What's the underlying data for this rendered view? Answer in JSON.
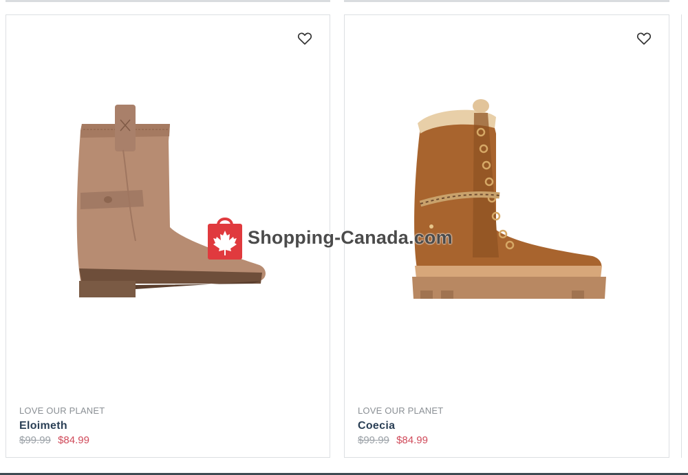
{
  "products": [
    {
      "collection": "LOVE OUR PLANET",
      "name": "Eloimeth",
      "old_price": "$99.99",
      "sale_price": "$84.99",
      "wishlist_icon": "heart-outline-icon",
      "image": "tan-suede-ankle-boot"
    },
    {
      "collection": "LOVE OUR PLANET",
      "name": "Coecia",
      "old_price": "$99.99",
      "sale_price": "$84.99",
      "wishlist_icon": "heart-outline-icon",
      "image": "cognac-lace-up-shearling-boot"
    }
  ],
  "watermark": {
    "text": "Shopping-Canada.com",
    "logo_icon": "maple-leaf-bag-icon",
    "logo_color": "#e03a3e"
  },
  "colors": {
    "name_text": "#2a3f55",
    "sale_price": "#d04a5a",
    "old_price": "#9aa0a6"
  }
}
